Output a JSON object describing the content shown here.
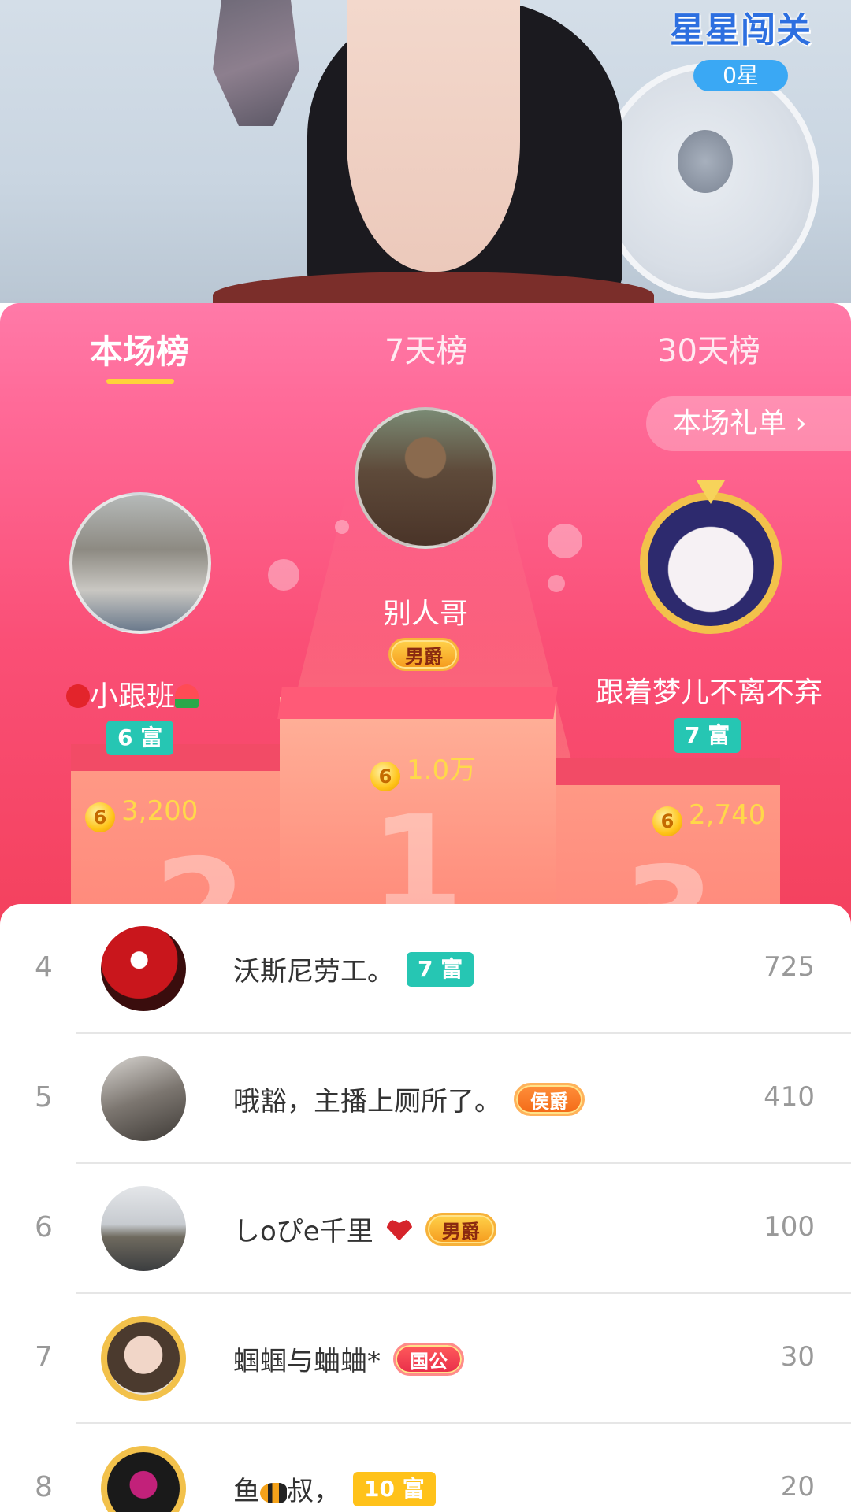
{
  "stream": {
    "game_title": "星星闯关",
    "stars": "0星"
  },
  "tabs": [
    {
      "label": "本场榜",
      "active": true
    },
    {
      "label": "7天榜",
      "active": false
    },
    {
      "label": "30天榜",
      "active": false
    }
  ],
  "gift_link": "本场礼单 ›",
  "top3": [
    {
      "rank": 1,
      "name": "别人哥",
      "badge": "男爵",
      "amount": "1.0万",
      "pedestal": "1"
    },
    {
      "rank": 2,
      "name": "小跟班",
      "badge": "6 富",
      "amount": "3,200",
      "pedestal": "2"
    },
    {
      "rank": 3,
      "name": "跟着梦儿不离不弃",
      "badge": "7 富",
      "amount": "2,740",
      "pedestal": "3"
    }
  ],
  "coin_symbol": "6",
  "list": [
    {
      "rank": "4",
      "name": "沃斯尼劳工。",
      "badge": "7 富",
      "badge_type": "rich",
      "score": "725"
    },
    {
      "rank": "5",
      "name": "哦豁，主播上厕所了。",
      "badge": "侯爵",
      "badge_type": "noble-orange",
      "score": "410"
    },
    {
      "rank": "6",
      "name": "しoぴe千里",
      "badge": "男爵",
      "badge_type": "noble",
      "score": "100"
    },
    {
      "rank": "7",
      "name": "蝈蝈与蛐蛐*",
      "badge": "国公",
      "badge_type": "noble-red",
      "score": "30"
    },
    {
      "rank": "8",
      "name_a": "鱼",
      "name_b": "叔，",
      "badge": "10 富",
      "badge_type": "rich-gold",
      "score": "20"
    }
  ],
  "colors": {
    "accent_pink": "#ff6a98",
    "tab_underline": "#ffd23a",
    "rich_badge": "#26c6b3",
    "coin_text": "#ffd84a"
  }
}
